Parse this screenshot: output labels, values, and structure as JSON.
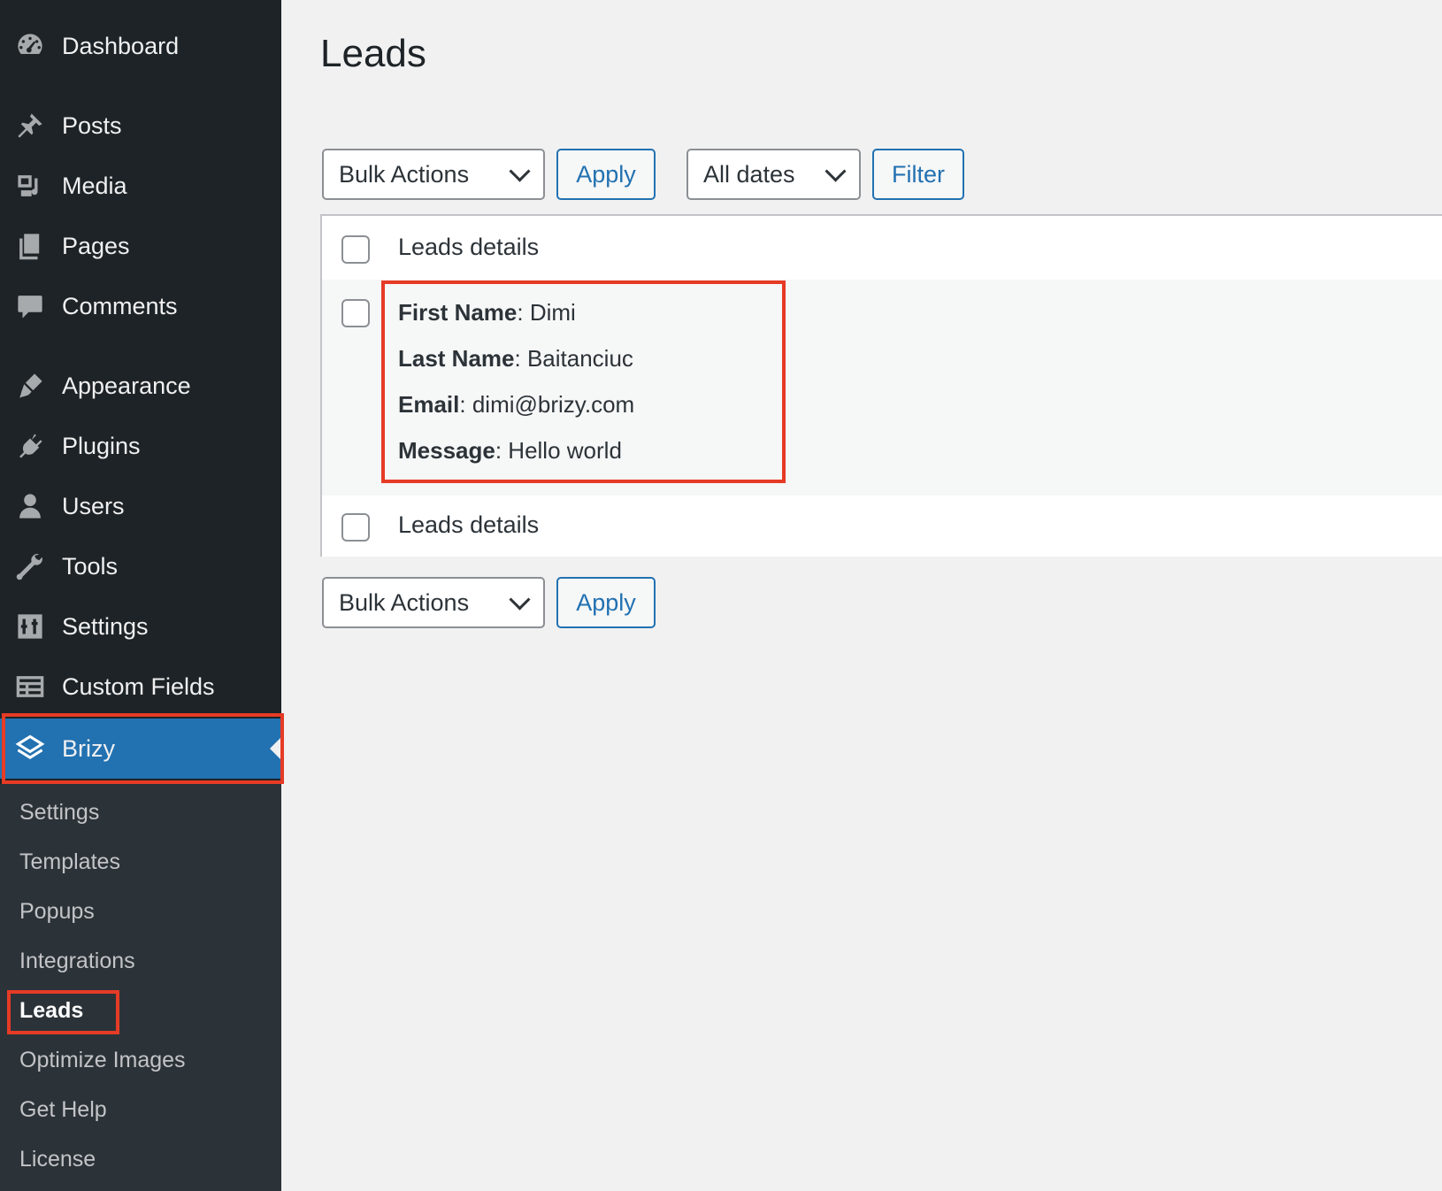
{
  "sidebar": {
    "items": [
      {
        "label": "Dashboard",
        "icon": "dashboard-icon"
      },
      {
        "label": "Posts",
        "icon": "pin-icon"
      },
      {
        "label": "Media",
        "icon": "media-icon"
      },
      {
        "label": "Pages",
        "icon": "pages-icon"
      },
      {
        "label": "Comments",
        "icon": "comment-icon"
      },
      {
        "label": "Appearance",
        "icon": "brush-icon"
      },
      {
        "label": "Plugins",
        "icon": "plugin-icon"
      },
      {
        "label": "Users",
        "icon": "user-icon"
      },
      {
        "label": "Tools",
        "icon": "wrench-icon"
      },
      {
        "label": "Settings",
        "icon": "settings-sliders-icon"
      },
      {
        "label": "Custom Fields",
        "icon": "table-icon"
      },
      {
        "label": "Brizy",
        "icon": "layers-icon"
      }
    ],
    "submenu": [
      "Settings",
      "Templates",
      "Popups",
      "Integrations",
      "Leads",
      "Optimize Images",
      "Get Help",
      "License"
    ]
  },
  "page": {
    "title": "Leads",
    "bulk_actions": "Bulk Actions",
    "apply": "Apply",
    "all_dates": "All dates",
    "filter": "Filter"
  },
  "table": {
    "header": "Leads details",
    "footer": "Leads details",
    "lead": {
      "first_name_label": "First Name",
      "first_name": "Dimi",
      "last_name_label": "Last Name",
      "last_name": "Baitanciuc",
      "email_label": "Email",
      "email": "dimi@brizy.com",
      "message_label": "Message",
      "message": "Hello world"
    }
  },
  "colors": {
    "sidebar_bg": "#1d2327",
    "submenu_bg": "#2c3338",
    "accent": "#2271b1",
    "highlight": "#e63b26"
  }
}
